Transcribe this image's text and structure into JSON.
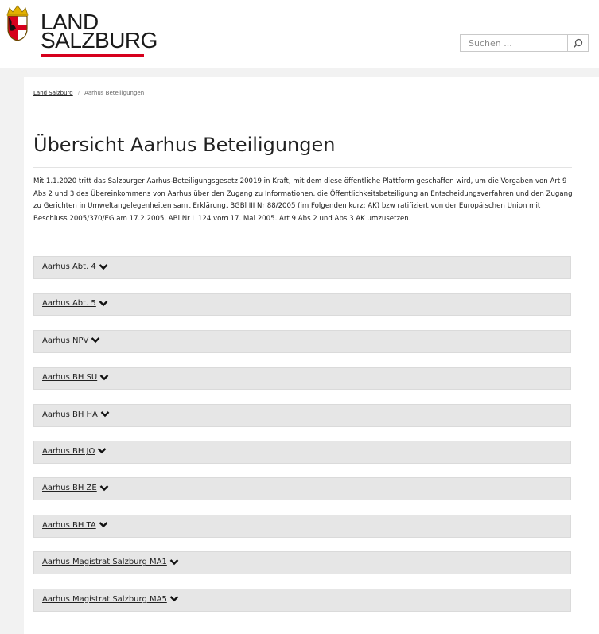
{
  "header": {
    "logo": {
      "line1": "LAND",
      "line2": "SALZBURG",
      "accent_color": "#d6001c"
    },
    "search": {
      "placeholder": "Suchen ...",
      "value": "",
      "button_icon": "search-icon"
    }
  },
  "breadcrumb": {
    "home": "Land Salzburg",
    "current": "Aarhus Beteiligungen"
  },
  "page": {
    "title": "Übersicht Aarhus Beteiligungen",
    "intro": "Mit 1.1.2020 tritt das Salzburger Aarhus-Beteiligungsgesetz 20019 in Kraft, mit dem diese öffentliche Plattform geschaffen wird, um die Vorgaben von Art 9 Abs 2 und 3 des Übereinkommens von Aarhus über den Zugang zu Informationen, die Öffentlichkeitsbeteiligung an Entscheidungsverfahren und den Zugang zu Gerichten in Umweltangelegenheiten samt Erklärung, BGBl III Nr 88/2005 (im Folgenden kurz: AK) bzw ratifiziert von der Europäischen Union mit Beschluss 2005/370/EG am 17.2.2005, ABl Nr L 124 vom 17. Mai 2005. Art 9 Abs 2 und Abs 3 AK umzusetzen."
  },
  "accordion": {
    "expand_icon": "chevron-down-icon",
    "items": [
      {
        "label": "Aarhus Abt. 4"
      },
      {
        "label": "Aarhus Abt. 5"
      },
      {
        "label": "Aarhus NPV"
      },
      {
        "label": "Aarhus BH SU"
      },
      {
        "label": "Aarhus BH HA"
      },
      {
        "label": "Aarhus BH JO"
      },
      {
        "label": "Aarhus BH ZE"
      },
      {
        "label": "Aarhus BH TA"
      },
      {
        "label": "Aarhus Magistrat Salzburg MA1"
      },
      {
        "label": "Aarhus Magistrat Salzburg MA5"
      }
    ]
  }
}
